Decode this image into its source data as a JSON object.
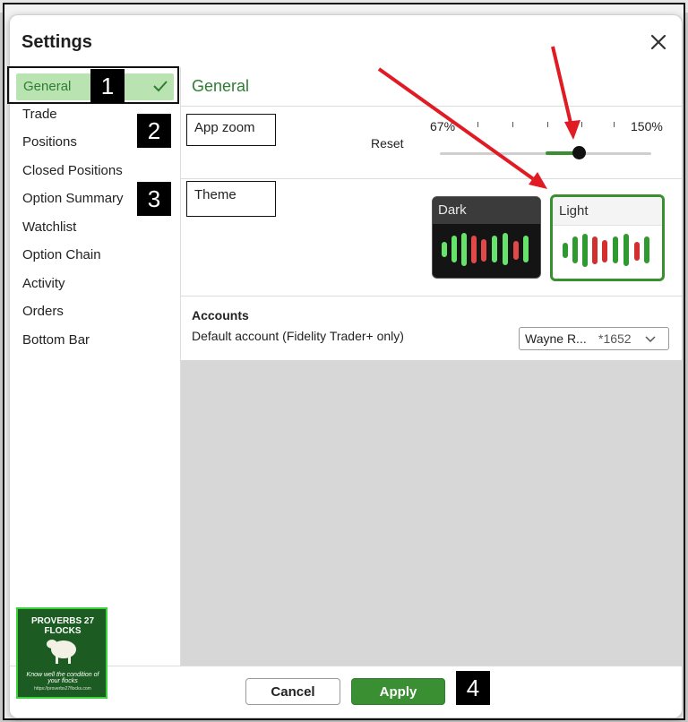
{
  "dialog": {
    "title": "Settings"
  },
  "sidebar": {
    "items": [
      {
        "label": "General",
        "active": true
      },
      {
        "label": "Trade"
      },
      {
        "label": "Positions"
      },
      {
        "label": "Closed Positions"
      },
      {
        "label": "Option Summary"
      },
      {
        "label": "Watchlist"
      },
      {
        "label": "Option Chain"
      },
      {
        "label": "Activity"
      },
      {
        "label": "Orders"
      },
      {
        "label": "Bottom Bar"
      }
    ]
  },
  "main": {
    "title": "General",
    "app_zoom": {
      "label": "App zoom",
      "reset_label": "Reset",
      "min_label": "67%",
      "max_label": "150%",
      "level_fraction": 0.7
    },
    "theme": {
      "label": "Theme",
      "options": [
        {
          "label": "Dark",
          "selected": false
        },
        {
          "label": "Light",
          "selected": true
        }
      ]
    },
    "accounts": {
      "heading": "Accounts",
      "default_label": "Default account (Fidelity Trader+ only)",
      "selected_name": "Wayne R...",
      "selected_number": "*1652"
    }
  },
  "footer": {
    "cancel_label": "Cancel",
    "apply_label": "Apply"
  },
  "callouts": [
    "1",
    "2",
    "3",
    "4"
  ],
  "logo": {
    "title": "PROVERBS 27 FLOCKS",
    "tagline": "Know well the condition of your flocks",
    "url": "https://proverbs27flocks.com"
  },
  "colors": {
    "accent_green": "#3a8f32",
    "active_bg": "#b9e4b2",
    "arrow_red": "#e01b24",
    "dark_card": "#141414",
    "bull_green": "#66e36a",
    "bear_red": "#e34848"
  }
}
